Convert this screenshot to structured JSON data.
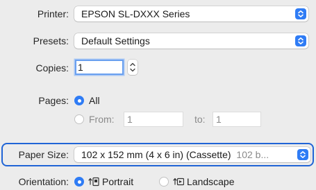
{
  "printer": {
    "label": "Printer:",
    "value": "EPSON SL-DXXX Series"
  },
  "presets": {
    "label": "Presets:",
    "value": "Default Settings"
  },
  "copies": {
    "label": "Copies:",
    "value": "1"
  },
  "pages": {
    "label": "Pages:",
    "all_label": "All",
    "from_label": "From:",
    "from_value": "1",
    "to_label": "to:",
    "to_value": "1",
    "selected": "All"
  },
  "paper_size": {
    "label": "Paper Size:",
    "value": "102 x 152 mm (4 x 6 in) (Cassette)",
    "suffix": "102 b..."
  },
  "orientation": {
    "label": "Orientation:",
    "portrait_label": "Portrait",
    "landscape_label": "Landscape",
    "selected": "Portrait"
  },
  "colors": {
    "accent": "#2f7cf5",
    "highlight_border": "#2064d6",
    "background": "#ececec"
  },
  "icons": {
    "popup": "chevron-up-down-icon",
    "stepper": "stepper-arrows-icon",
    "portrait": "portrait-orientation-icon",
    "landscape": "landscape-orientation-icon"
  }
}
